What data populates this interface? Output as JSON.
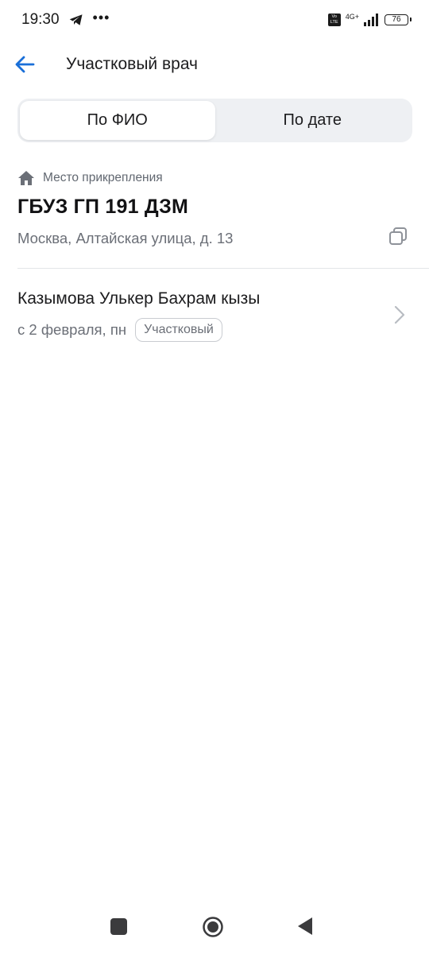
{
  "status_bar": {
    "time": "19:30",
    "more": "•••",
    "volte": "Vo LTE",
    "network": "4G+",
    "battery": "76"
  },
  "header": {
    "title": "Участковый врач"
  },
  "tabs": [
    {
      "label": "По ФИО",
      "active": true
    },
    {
      "label": "По дате",
      "active": false
    }
  ],
  "attachment": {
    "caption": "Место прикрепления",
    "clinic_name": "ГБУЗ ГП 191 ДЗМ",
    "address": "Москва, Алтайская улица, д. 13"
  },
  "doctor": {
    "name": "Казымова Улькер Бахрам кызы",
    "since": "с 2 февраля, пн",
    "badge": "Участковый"
  },
  "colors": {
    "accent": "#1a6fd8",
    "text_primary": "#1c1c1e",
    "text_secondary": "#6b6f77",
    "segment_bg": "#eef0f3"
  },
  "icons": {
    "back": "arrow-left-icon",
    "home": "house-icon",
    "copy": "copy-icon",
    "chevron": "chevron-right-icon",
    "telegram": "telegram-icon"
  }
}
